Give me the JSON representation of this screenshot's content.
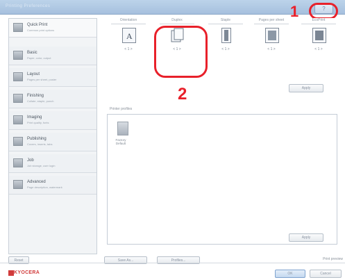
{
  "titlebar": {
    "title": "Printing Preferences",
    "help_label": "?"
  },
  "callouts": {
    "one": "1",
    "two": "2"
  },
  "sidebar": {
    "items": [
      {
        "label": "Quick Print",
        "sub": "Common print options"
      },
      {
        "label": "Basic",
        "sub": "Paper, color, output"
      },
      {
        "label": "Layout",
        "sub": "Pages per sheet, poster"
      },
      {
        "label": "Finishing",
        "sub": "Collate, staple, punch"
      },
      {
        "label": "Imaging",
        "sub": "Print quality, fonts"
      },
      {
        "label": "Publishing",
        "sub": "Covers, inserts, tabs"
      },
      {
        "label": "Job",
        "sub": "Job storage, user login"
      },
      {
        "label": "Advanced",
        "sub": "Page description, watermark"
      }
    ]
  },
  "main": {
    "tabs": [
      {
        "title": "Orientation",
        "caption": "< 1 >"
      },
      {
        "title": "Duplex",
        "caption": "< 1 >"
      },
      {
        "title": "Staple",
        "caption": "< 1 >"
      },
      {
        "title": "Pages per sheet",
        "caption": "< 1 >"
      },
      {
        "title": "EcoPrint",
        "caption": "< 1 >"
      }
    ],
    "apply_label": "Apply",
    "profiles_label": "Printer profiles",
    "profile_name": "Factory Default",
    "profile_apply_label": "Apply"
  },
  "footer": {
    "reset_label": "Reset",
    "save_label": "Save As...",
    "profiles_label": "Profiles...",
    "show_label": "Print preview",
    "logo": "KYOCERA",
    "ok_label": "OK",
    "cancel_label": "Cancel"
  }
}
